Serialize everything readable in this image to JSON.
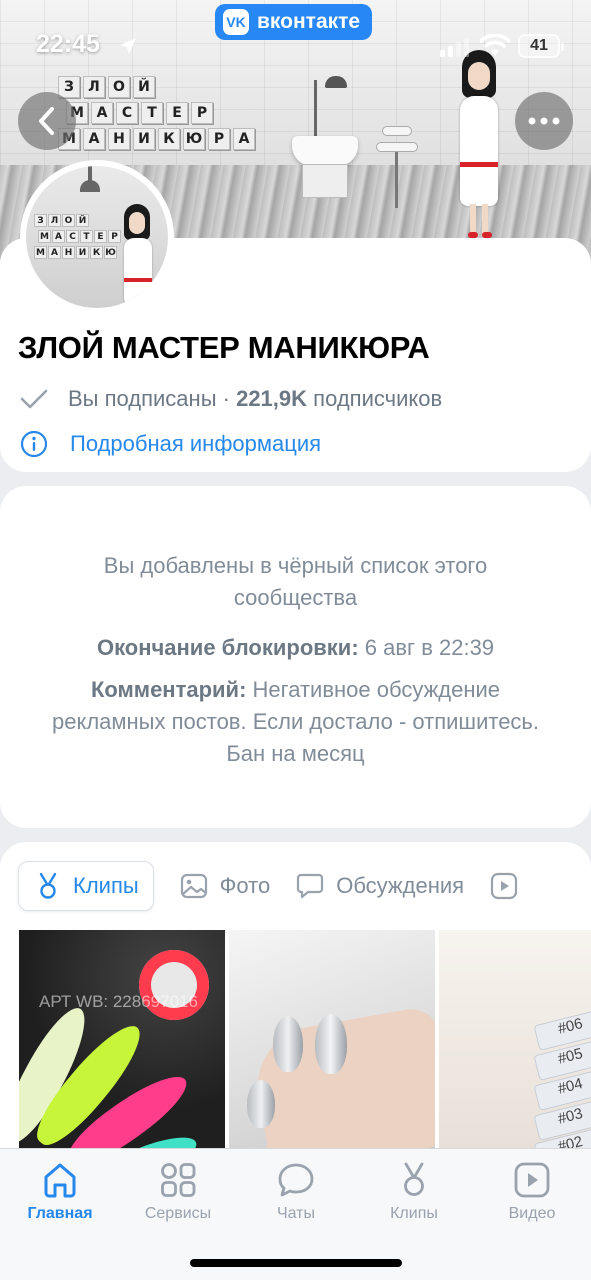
{
  "status_bar": {
    "time": "22:45",
    "battery": "41"
  },
  "vk_badge": {
    "logo": "VK",
    "label": "вконтакте"
  },
  "cover": {
    "tiles": [
      [
        "З",
        "Л",
        "О",
        "Й"
      ],
      [
        "М",
        "А",
        "С",
        "Т",
        "Е",
        "Р"
      ],
      [
        "М",
        "А",
        "Н",
        "И",
        "К",
        "Ю",
        "Р",
        "А"
      ]
    ]
  },
  "avatar": {
    "tiles": [
      [
        "З",
        "Л",
        "О",
        "Й"
      ],
      [
        "М",
        "А",
        "С",
        "Т",
        "Е",
        "Р"
      ],
      [
        "М",
        "А",
        "Н",
        "И",
        "К",
        "Ю"
      ]
    ]
  },
  "profile": {
    "name": "ЗЛОЙ МАСТЕР МАНИКЮРА",
    "subscribed": "Вы подписаны",
    "separator": "·",
    "subscribers_count": "221,9K",
    "subscribers_label": "подписчиков",
    "more_info": "Подробная информация"
  },
  "blacklist": {
    "title": "Вы добавлены в чёрный список этого сообщества",
    "end_label": "Окончание блокировки:",
    "end_value": "6 авг в 22:39",
    "comment_label": "Комментарий:",
    "comment_value": "Негативное обсуждение рекламных постов. Если достало - отпишитесь. Бан на месяц"
  },
  "tabs": [
    {
      "label": "Клипы",
      "icon": "clips-icon",
      "active": true
    },
    {
      "label": "Фото",
      "icon": "photo-icon",
      "active": false
    },
    {
      "label": "Обсуждения",
      "icon": "discussions-icon",
      "active": false
    },
    {
      "label": "",
      "icon": "video-icon",
      "active": false
    }
  ],
  "clips": {
    "watermark": "АРТ WB: 228697016",
    "swatches": [
      "#06",
      "#05",
      "#04",
      "#03",
      "#02"
    ]
  },
  "bottom_nav": [
    {
      "label": "Главная",
      "icon": "home-icon",
      "active": true
    },
    {
      "label": "Сервисы",
      "icon": "services-icon",
      "active": false
    },
    {
      "label": "Чаты",
      "icon": "chats-icon",
      "active": false
    },
    {
      "label": "Клипы",
      "icon": "clips-icon",
      "active": false
    },
    {
      "label": "Видео",
      "icon": "video-icon",
      "active": false
    }
  ],
  "colors": {
    "accent": "#2688eb",
    "vk_blue": "#2787f5",
    "secondary_text": "#818c99",
    "background": "#ebedf0"
  }
}
